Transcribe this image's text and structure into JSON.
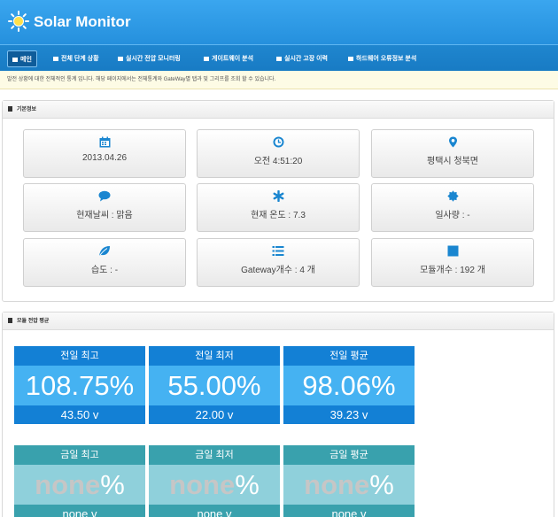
{
  "header": {
    "brand": "Solar Monitor",
    "logo_icon": "sun-icon"
  },
  "nav": {
    "items": [
      {
        "label": "메인",
        "icon": "home-icon",
        "active": true
      },
      {
        "label": "전체 단계 상황",
        "icon": "grid-icon"
      },
      {
        "label": "실시간 전압 모니터링",
        "icon": "monitor-icon"
      },
      {
        "label": "게이트웨이 분석",
        "icon": "gateway-icon"
      },
      {
        "label": "실시간 고장 이력",
        "icon": "history-icon"
      },
      {
        "label": "하드웨어 오류정보 분석",
        "icon": "hardware-icon"
      }
    ]
  },
  "notice": {
    "text": "발전 상황에 대한 전체적인 통계 입니다. 해당 페이지에서는 전체통계와 GateWay별 탭과 및 그리프를 조회 할 수 있습니다."
  },
  "basic_info": {
    "title": "기본정보",
    "boxes": [
      {
        "icon": "calendar-icon",
        "text": "2013.04.26"
      },
      {
        "icon": "clock-icon",
        "text": "오전 4:51:20"
      },
      {
        "icon": "map-marker-icon",
        "text": "평택시 청북면"
      },
      {
        "icon": "chat-icon",
        "text": "현재날씨 : 맑음"
      },
      {
        "icon": "asterisk-icon",
        "text": "현재 온도 : 7.3"
      },
      {
        "icon": "certificate-icon",
        "text": "일사량 : -"
      },
      {
        "icon": "leaf-icon",
        "text": "습도 : -"
      },
      {
        "icon": "list-icon",
        "text": "Gateway개수 : 4 개"
      },
      {
        "icon": "stop-icon",
        "text": "모듈개수 : 192 개"
      }
    ]
  },
  "module_voltage": {
    "title": "모듈 전압 평균",
    "yesterday": [
      {
        "label": "전일 최고",
        "percent": "108.75%",
        "volt": "43.50 v"
      },
      {
        "label": "전일 최저",
        "percent": "55.00%",
        "volt": "22.00 v"
      },
      {
        "label": "전일 평균",
        "percent": "98.06%",
        "volt": "39.23 v"
      }
    ],
    "today": [
      {
        "label": "금일 최고",
        "percent_value": "none",
        "percent_unit": "%",
        "volt": "none v"
      },
      {
        "label": "금일 최저",
        "percent_value": "none",
        "percent_unit": "%",
        "volt": "none v"
      },
      {
        "label": "금일 평균",
        "percent_value": "none",
        "percent_unit": "%",
        "volt": "none v"
      }
    ]
  },
  "colors": {
    "header": "#2b97e3",
    "nav": "#1b80c9",
    "stat_blue": "#1380d5",
    "stat_teal": "#39a1ad"
  }
}
